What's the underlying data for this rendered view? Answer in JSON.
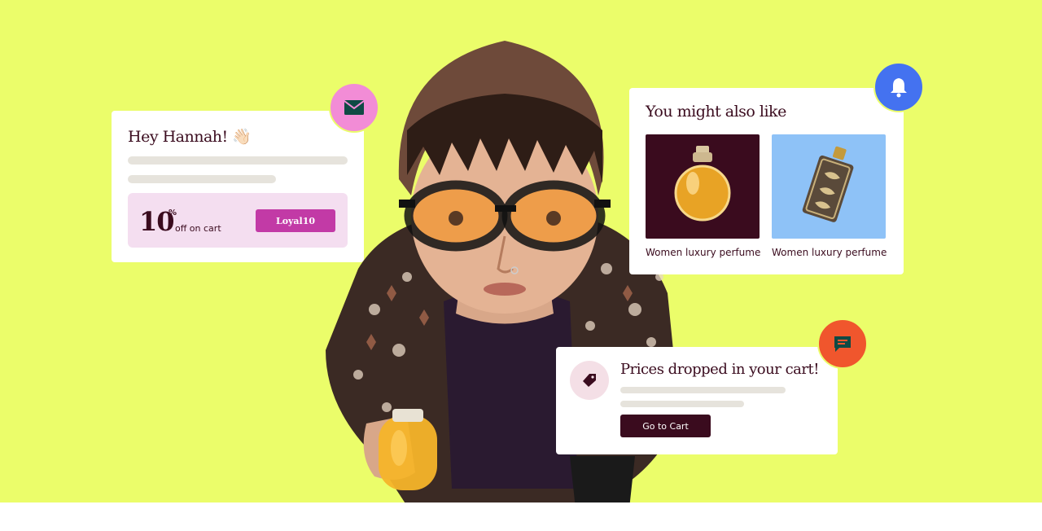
{
  "greeting": {
    "title": "Hey Hannah! 👋🏻",
    "promo_number": "10",
    "promo_percent": "%",
    "promo_text": "off on cart",
    "promo_code_button": "Loyal10"
  },
  "recommendations": {
    "title": "You might also like",
    "products": [
      {
        "name": "Women luxury perfume",
        "image_bg": "#3a0b1e"
      },
      {
        "name": "Women luxury perfume",
        "image_bg": "#8ec2f7"
      }
    ]
  },
  "price_alert": {
    "title": "Prices dropped in your cart!",
    "button_label": "Go to Cart"
  },
  "badges": {
    "mail": {
      "icon": "mail-icon",
      "color": "#f28cd6"
    },
    "bell": {
      "icon": "bell-icon",
      "color": "#4472f0"
    },
    "chat": {
      "icon": "chat-icon",
      "color": "#f0562d"
    }
  },
  "colors": {
    "background": "#ebfd6a",
    "brand_dark": "#3a0b1e",
    "promo_button": "#c23aa6",
    "promo_bg": "#f4def0"
  }
}
